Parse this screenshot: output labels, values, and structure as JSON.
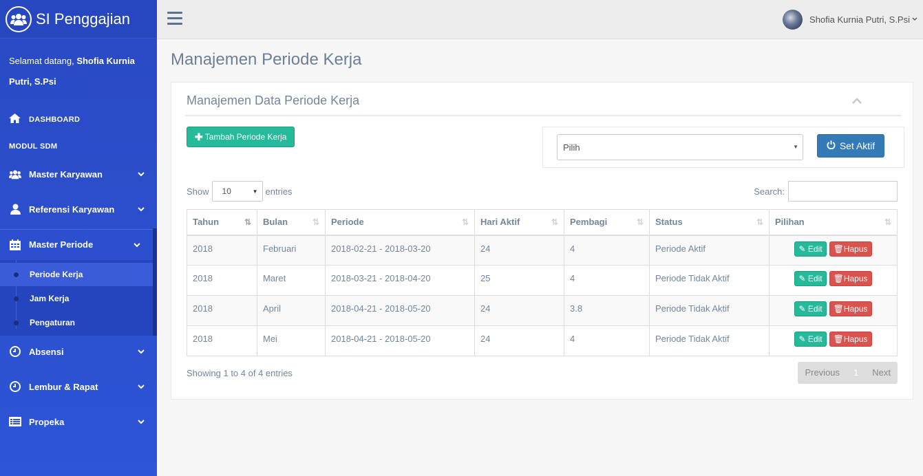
{
  "app": {
    "title": "SI Penggajian"
  },
  "welcome": {
    "prefix": "Selamat datang,",
    "name": "Shofia Kurnia Putri, S.Psi"
  },
  "sidebar": {
    "dashboard": "DASHBOARD",
    "section": "MODUL SDM",
    "items": [
      {
        "label": "Master Karyawan",
        "icon": "users-icon"
      },
      {
        "label": "Referensi Karyawan",
        "icon": "user-icon"
      },
      {
        "label": "Master Periode",
        "icon": "calendar-icon"
      },
      {
        "label": "Absensi",
        "icon": "clock-icon"
      },
      {
        "label": "Lembur & Rapat",
        "icon": "clock-icon"
      },
      {
        "label": "Propeka",
        "icon": "list-icon"
      }
    ],
    "submenu": [
      {
        "label": "Periode Kerja"
      },
      {
        "label": "Jam Kerja"
      },
      {
        "label": "Pengaturan"
      }
    ]
  },
  "topnav": {
    "user_name": "Shofia Kurnia Putri, S.Psi"
  },
  "page": {
    "title": "Manajemen Periode Kerja"
  },
  "panel": {
    "title": "Manajemen Data Periode Kerja",
    "add_button": "Tambah Periode Kerja",
    "select_value": "Pilih",
    "set_button": "Set Aktif"
  },
  "datatable": {
    "show_label": "Show",
    "length_value": "10",
    "entries_label": "entries",
    "search_label": "Search:",
    "columns": [
      "Tahun",
      "Bulan",
      "Periode",
      "Hari Aktif",
      "Pembagi",
      "Status",
      "Pilihan"
    ],
    "rows": [
      {
        "tahun": "2018",
        "bulan": "Februari",
        "periode": "2018-02-21 - 2018-03-20",
        "hari": "24",
        "pembagi": "4",
        "status": "Periode Aktif"
      },
      {
        "tahun": "2018",
        "bulan": "Maret",
        "periode": "2018-03-21 - 2018-04-20",
        "hari": "25",
        "pembagi": "4",
        "status": "Periode Tidak Aktif"
      },
      {
        "tahun": "2018",
        "bulan": "April",
        "periode": "2018-04-21 - 2018-05-20",
        "hari": "24",
        "pembagi": "3.8",
        "status": "Periode Tidak Aktif"
      },
      {
        "tahun": "2018",
        "bulan": "Mei",
        "periode": "2018-04-21 - 2018-05-20",
        "hari": "24",
        "pembagi": "4",
        "status": "Periode Tidak Aktif"
      }
    ],
    "edit_label": "Edit",
    "delete_label": "Hapus",
    "info": "Showing 1 to 4 of 4 entries",
    "pager": {
      "previous": "Previous",
      "current": "1",
      "next": "Next"
    }
  },
  "colors": {
    "sidebar": "#2d55d6",
    "success": "#26b99a",
    "danger": "#d9534f",
    "primary": "#337ab7"
  }
}
